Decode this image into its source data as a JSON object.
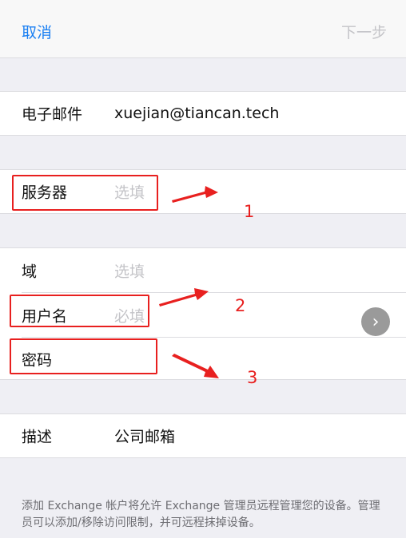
{
  "nav": {
    "cancel": "取消",
    "next": "下一步"
  },
  "form": {
    "email": {
      "label": "电子邮件",
      "value": "xuejian@tiancan.tech"
    },
    "server": {
      "label": "服务器",
      "placeholder": "选填"
    },
    "domain": {
      "label": "域",
      "placeholder": "选填"
    },
    "username": {
      "label": "用户名",
      "placeholder": "必填"
    },
    "password": {
      "label": "密码",
      "placeholder": ""
    },
    "description": {
      "label": "描述",
      "value": "公司邮箱"
    }
  },
  "annotations": [
    "1",
    "2",
    "3"
  ],
  "footer": "添加 Exchange 帐户将允许 Exchange 管理员远程管理您的设备。管理员可以添加/移除访问限制，并可远程抹掉设备。",
  "colors": {
    "accent": "#1a7ff2",
    "annotation": "#e8201f",
    "placeholder": "#c4c4c8"
  },
  "icons": {
    "next_arrow": "chevron-right-icon"
  }
}
